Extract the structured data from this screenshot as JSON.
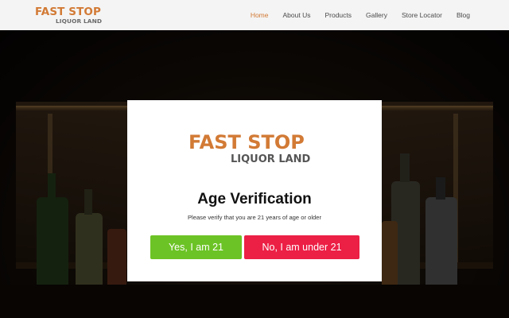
{
  "header": {
    "logo_line1": "FAST STOP",
    "logo_line2": "LIQUOR LAND",
    "nav": [
      {
        "label": "Home",
        "active": true
      },
      {
        "label": "About Us"
      },
      {
        "label": "Products"
      },
      {
        "label": "Gallery"
      },
      {
        "label": "Store Locator"
      },
      {
        "label": "Blog"
      }
    ]
  },
  "modal": {
    "logo_line1": "FAST STOP",
    "logo_line2": "LIQUOR LAND",
    "title": "Age Verification",
    "subtitle": "Please verify that you are 21 years of age or older",
    "yes_label": "Yes, I am 21",
    "no_label": "No, I am under 21"
  },
  "colors": {
    "brand_orange": "#d27a35",
    "yes_green": "#6cc325",
    "no_red": "#ec1f45"
  }
}
